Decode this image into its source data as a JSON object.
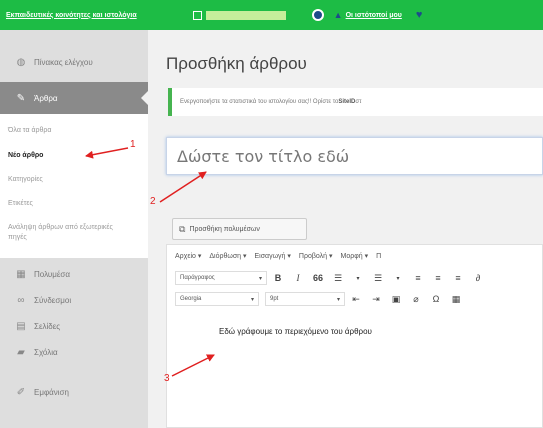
{
  "adminbar": {
    "site_name": "Εκπαιδευτικές κοινότητες και ιστολόγια",
    "my_sites_label": "Οι ιστότοποί μου"
  },
  "sidebar": {
    "items": [
      {
        "label": "Πίνακας ελέγχου",
        "icon": "dashboard-icon"
      },
      {
        "label": "Άρθρα",
        "icon": "pin-icon",
        "active": true
      },
      {
        "label": "Πολυμέσα",
        "icon": "media-icon"
      },
      {
        "label": "Σύνδεσμοι",
        "icon": "link-icon"
      },
      {
        "label": "Σελίδες",
        "icon": "pages-icon"
      },
      {
        "label": "Σχόλια",
        "icon": "comments-icon"
      },
      {
        "label": "Εμφάνιση",
        "icon": "appearance-icon"
      }
    ],
    "submenu": [
      {
        "label": "Όλα τα άρθρα"
      },
      {
        "label": "Νέο άρθρο",
        "current": true
      },
      {
        "label": "Κατηγορίες"
      },
      {
        "label": "Ετικέτες"
      },
      {
        "label": "Ανάληψη άρθρων από εξωτερικές πηγές"
      }
    ]
  },
  "main": {
    "page_title": "Προσθήκη άρθρου",
    "notice_text": "Ενεργοποιήστε τα στατιστικά του ιστολογίου σας!! Ορίστε το ",
    "notice_bold": "SiteID",
    "notice_tail": " στ",
    "title_placeholder": "Δώστε τον τίτλο εδώ",
    "add_media_label": "Προσθήκη πολυμέσων",
    "editor": {
      "menubar": [
        "Αρχείο ▾",
        "Διόρθωση ▾",
        "Εισαγωγή ▾",
        "Προβολή ▾",
        "Μορφή ▾",
        "Π"
      ],
      "format_select": "Παράγραφος",
      "bold_glyph": "B",
      "italic_glyph": "I",
      "quote_glyph": "66",
      "font_select": "Georgia",
      "size_select": "9pt",
      "body_text": "Εδώ γράφουμε το περιεχόμενο του άρθρου"
    }
  },
  "annotations": {
    "step1": "1",
    "step2": "2",
    "step3": "3",
    "arrow_color": "#e02020"
  }
}
